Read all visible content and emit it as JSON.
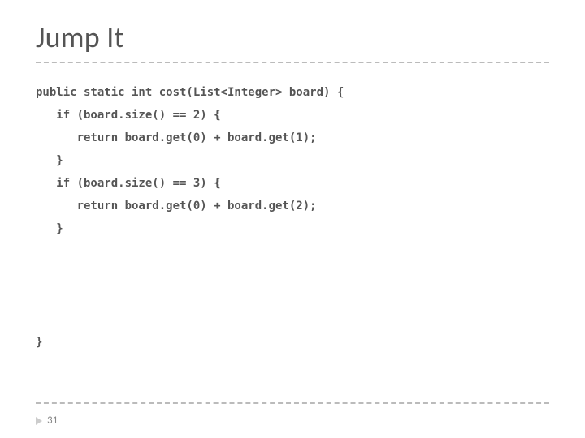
{
  "slide": {
    "title": "Jump It",
    "page_number": "31",
    "code_lines": [
      "public static int cost(List<Integer> board) {",
      "   if (board.size() == 2) {",
      "      return board.get(0) + board.get(1);",
      "   }",
      "   if (board.size() == 3) {",
      "      return board.get(0) + board.get(2);",
      "   }",
      "",
      "",
      "",
      "",
      "}"
    ]
  }
}
